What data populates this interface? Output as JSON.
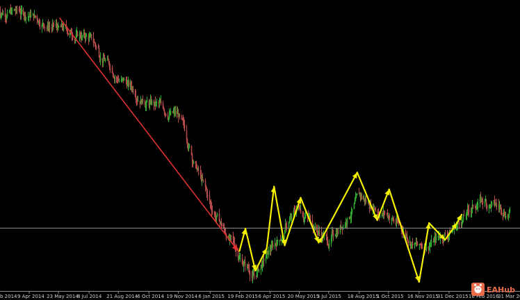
{
  "chart_data": {
    "type": "candlestick",
    "x_tick_labels": [
      "9 Apr 2014",
      "23 May 2014",
      "8 Jul 2014",
      "21 Aug 2014",
      "6 Oct 2014",
      "19 Nov 2014",
      "6 Jan 2015",
      "19 Feb 2015",
      "6 Apr 2015",
      "20 May 2015",
      "3 Jul 2015",
      "18 Aug 2015",
      "1 Oct 2015",
      "16 Nov 2015",
      "31 Dec 2015",
      "16 Feb 2016",
      "31 Mar 20"
    ],
    "x_tick_label_left_partial": "b 2014",
    "ylim": [
      0,
      100
    ],
    "grid": false,
    "horizontal_line_level": 20.3,
    "price_path_dates": [
      "2014-02-20",
      "2014-04-09",
      "2014-05-23",
      "2014-07-08",
      "2014-08-21",
      "2014-10-06",
      "2014-11-19",
      "2015-01-06",
      "2015-02-19",
      "2015-03-13",
      "2015-05-20",
      "2015-07-03",
      "2015-08-18",
      "2015-10-01",
      "2015-11-16",
      "2015-12-31",
      "2016-02-16",
      "2016-03-31"
    ],
    "price_path_values": [
      98,
      96.5,
      91,
      88,
      74,
      65,
      60,
      28,
      10,
      3,
      28,
      15,
      31,
      25,
      13,
      19,
      30,
      26
    ],
    "down_trend_arrow": {
      "from": {
        "date": "2014-05-25",
        "value": 95
      },
      "to": {
        "date": "2015-02-17",
        "value": 12
      },
      "color": "#e03030"
    },
    "zigzag": {
      "color": "#f5f000",
      "points": [
        {
          "date": "2015-02-19",
          "value": 12
        },
        {
          "date": "2015-02-28",
          "value": 20
        },
        {
          "date": "2015-03-15",
          "value": 5
        },
        {
          "date": "2015-04-01",
          "value": 13
        },
        {
          "date": "2015-04-12",
          "value": 35
        },
        {
          "date": "2015-04-28",
          "value": 14
        },
        {
          "date": "2015-05-22",
          "value": 31
        },
        {
          "date": "2015-06-18",
          "value": 15
        },
        {
          "date": "2015-06-24",
          "value": 17
        },
        {
          "date": "2015-08-15",
          "value": 40
        },
        {
          "date": "2015-09-14",
          "value": 23
        },
        {
          "date": "2015-10-02",
          "value": 34
        },
        {
          "date": "2015-11-16",
          "value": 1
        },
        {
          "date": "2015-12-01",
          "value": 22
        },
        {
          "date": "2015-12-25",
          "value": 16
        },
        {
          "date": "2016-01-12",
          "value": 22
        },
        {
          "date": "2016-01-19",
          "value": 25
        }
      ]
    },
    "colors": {
      "background": "#000000",
      "bull": "#2ea82e",
      "bear": "#b34b4b",
      "axis": "#8c8c8c",
      "hline": "#8c8c8c",
      "tick_text": "#cfcfcf"
    }
  },
  "watermark": {
    "text": "EAHub",
    "icon": "eahub-logo-icon",
    "color": "#e86b4a"
  }
}
